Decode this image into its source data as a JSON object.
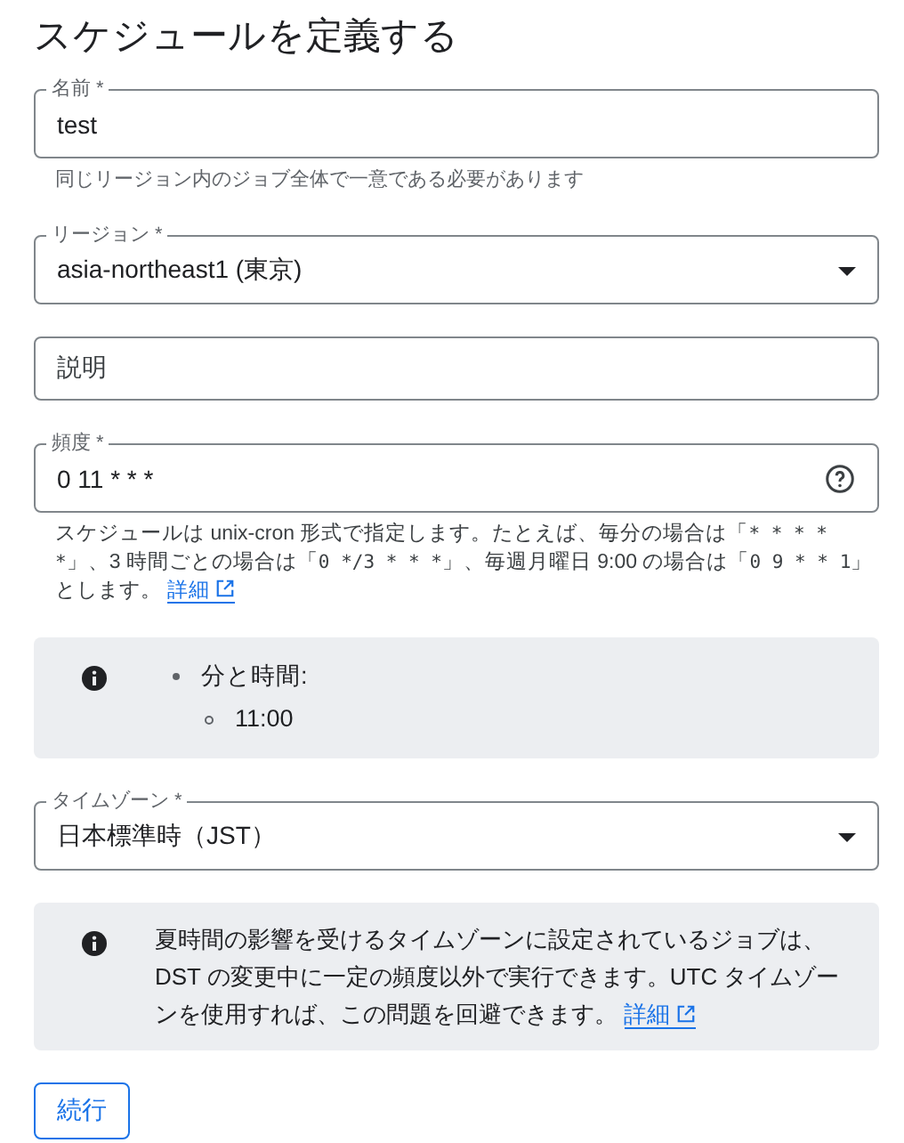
{
  "title": "スケジュールを定義する",
  "fields": [
    {
      "kind": "text",
      "label": "名前 *",
      "value": "test",
      "hint": "同じリージョン内のジョブ全体で一意である必要があります"
    },
    {
      "kind": "select",
      "label": "リージョン *",
      "value": "asia-northeast1 (東京)"
    },
    {
      "kind": "text",
      "placeholder": "説明"
    },
    {
      "kind": "help",
      "label": "頻度 *",
      "value": "0 11 * * *",
      "help": {
        "parts": [
          {
            "kind": "text",
            "text": "スケジュールは unix-cron 形式で指定します。たとえば、毎分の場合は「"
          },
          {
            "kind": "code",
            "text": "* * * * *"
          },
          {
            "kind": "text",
            "text": "」、3 時間ごとの場合は「"
          },
          {
            "kind": "code",
            "text": "0 */3 * * *"
          },
          {
            "kind": "text",
            "text": "」、毎週月曜日 9:00 の場合は「"
          },
          {
            "kind": "code",
            "text": "0 9 * * 1"
          },
          {
            "kind": "text",
            "text": "」とします。"
          }
        ],
        "link": "詳細"
      }
    },
    {
      "kind": "info",
      "items": [
        {
          "text": "分と時間:",
          "children": [
            {
              "text": "11:00"
            }
          ]
        }
      ]
    },
    {
      "kind": "select",
      "label": "タイムゾーン *",
      "value": "日本標準時（JST）"
    },
    {
      "kind": "info",
      "text": "夏時間の影響を受けるタイムゾーンに設定されているジョブは、DST の変更中に一定の頻度以外で実行できます。UTC タイムゾーンを使用すれば、この問題を回避できます。",
      "link": "詳細"
    }
  ],
  "button": "続行"
}
